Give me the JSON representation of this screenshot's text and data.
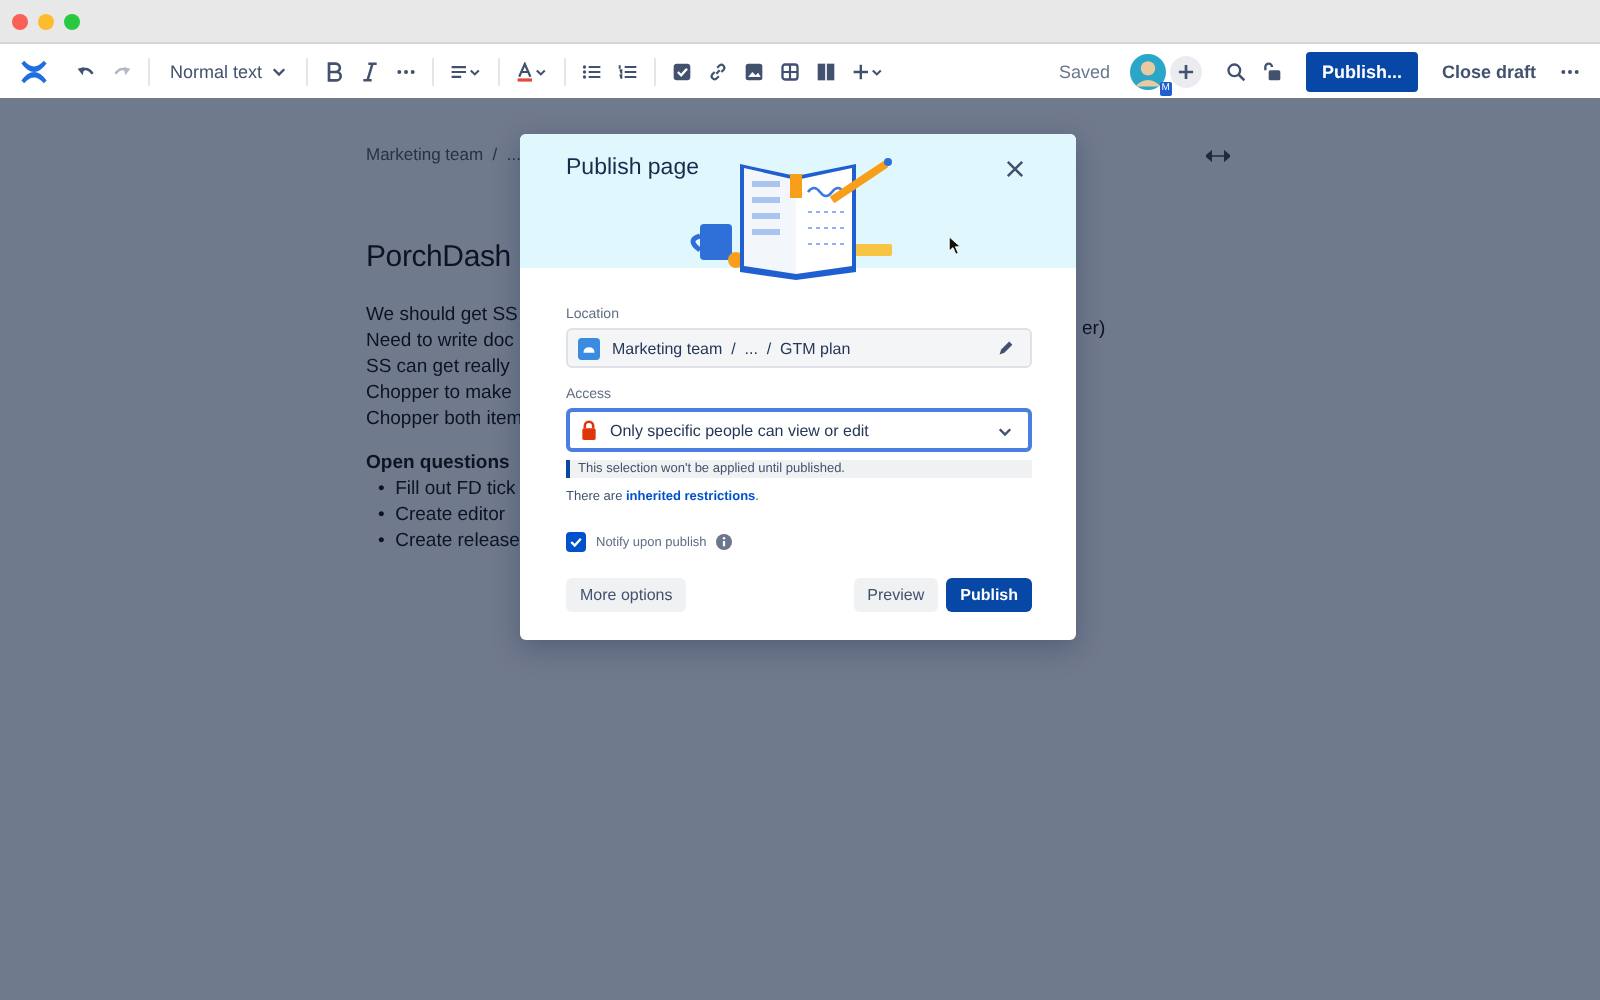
{
  "toolbar": {
    "text_style": "Normal text",
    "status": "Saved",
    "avatar_badge": "M",
    "publish_button": "Publish...",
    "close_button": "Close draft"
  },
  "document": {
    "breadcrumb": "Marketing team  /  ...",
    "title": "PorchDash",
    "lines": [
      "We should get SS",
      "Need to write doc",
      "SS can get really",
      "Chopper to make",
      "Chopper both item"
    ],
    "right_fragment": "er)",
    "section_heading": "Open questions",
    "bullet_marker": "•",
    "bullets": [
      "Fill out FD tick",
      "Create editor",
      "Create release"
    ]
  },
  "dialog": {
    "title": "Publish page",
    "location_label": "Location",
    "location_path": "Marketing team  /  ...  /  GTM plan",
    "access_label": "Access",
    "access_value": "Only specific people can view or edit",
    "notice": "This selection won't be applied until published.",
    "restrictions_prefix": "There are ",
    "restrictions_link": "inherited restrictions",
    "restrictions_suffix": ".",
    "notify": {
      "label": "Notify upon publish",
      "checked": true
    },
    "more_button": "More options",
    "preview_button": "Preview",
    "publish_button": "Publish"
  }
}
